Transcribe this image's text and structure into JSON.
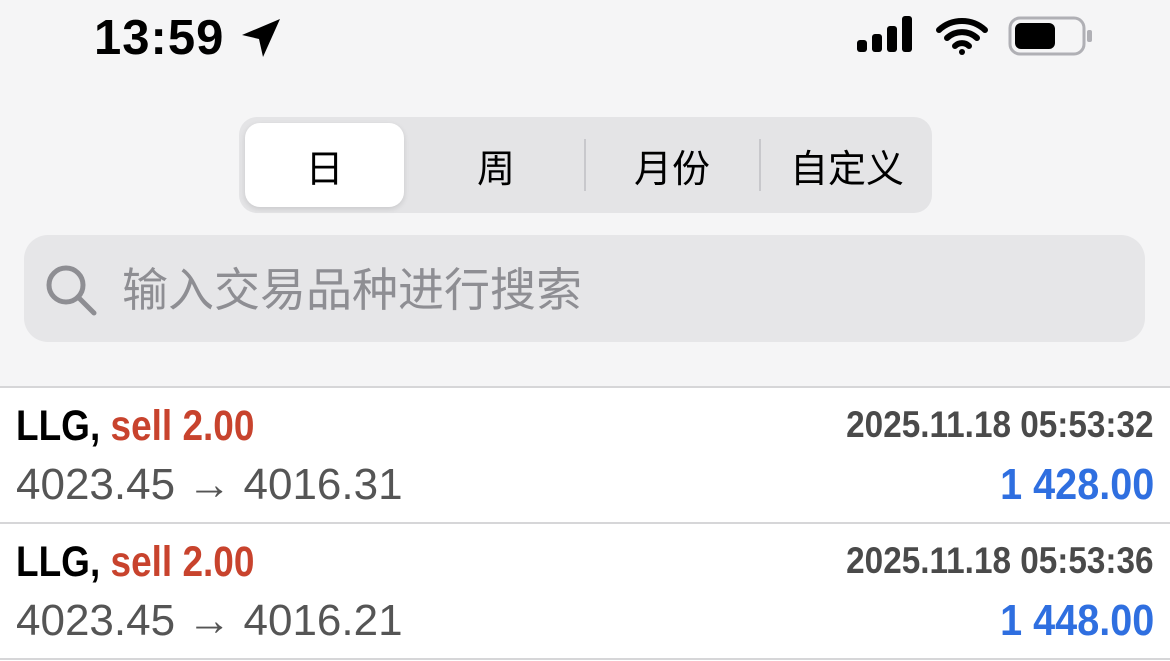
{
  "status_bar": {
    "time": "13:59",
    "icons": [
      "location-arrow-icon",
      "cellular-signal-icon",
      "wifi-icon",
      "battery-icon"
    ]
  },
  "segmented": {
    "tabs": [
      {
        "label": "日",
        "selected": true
      },
      {
        "label": "周",
        "selected": false
      },
      {
        "label": "月份",
        "selected": false
      },
      {
        "label": "自定义",
        "selected": false
      }
    ]
  },
  "search": {
    "placeholder": "输入交易品种进行搜索",
    "value": ""
  },
  "deals": [
    {
      "symbol": "LLG,",
      "side": "sell 2.00",
      "datetime": "2025.11.18 05:53:32",
      "prices": "4023.45 → 4016.31",
      "profit": "1 428.00"
    },
    {
      "symbol": "LLG,",
      "side": "sell 2.00",
      "datetime": "2025.11.18 05:53:36",
      "prices": "4023.45 → 4016.21",
      "profit": "1 448.00"
    }
  ],
  "colors": {
    "sell": "#c8432d",
    "profit": "#2f6fe0",
    "background": "#f5f5f6"
  }
}
